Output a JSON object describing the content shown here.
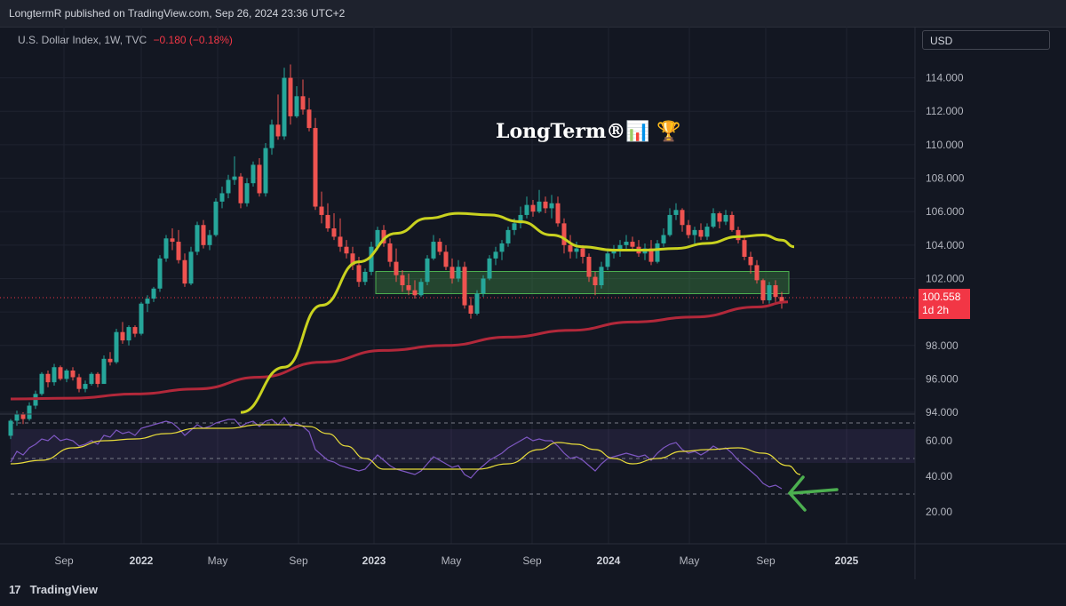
{
  "header": {
    "text": "LongtermR published on TradingView.com, Sep 26, 2024 23:36 UTC+2"
  },
  "legend": {
    "symbol": "U.S. Dollar Index, 1W, TVC",
    "change": "−0.180 (−0.18%)"
  },
  "currency_button": "USD",
  "watermark": "LongTerm®📊 🏆",
  "price_tag": {
    "price": "100.558",
    "countdown": "1d 2h"
  },
  "footer": {
    "brand": "TradingView",
    "logo_mark": "17"
  },
  "colors": {
    "up": "#26a69a",
    "down": "#ef5350",
    "ma_fast": "#c9d21f",
    "ma_slow": "#b2283a",
    "rsi": "#7e57c2",
    "rsi_ma": "#e8dc3a",
    "zone": "#4caf50"
  },
  "chart_data": [
    {
      "type": "candlestick",
      "title": "U.S. Dollar Index, 1W, TVC",
      "x_ticks": [
        "Sep",
        "2022",
        "May",
        "Sep",
        "2023",
        "May",
        "Sep",
        "2024",
        "May",
        "Sep",
        "2025"
      ],
      "y_ticks": [
        "94.000",
        "96.000",
        "98.000",
        "100.000",
        "102.000",
        "104.000",
        "106.000",
        "108.000",
        "110.000",
        "112.000",
        "114.000"
      ],
      "ylim": [
        93.95,
        115.2
      ],
      "last_price": 100.558,
      "ohlc": [
        [
          92.6,
          93.6,
          92.4,
          93.5
        ],
        [
          93.5,
          94.1,
          93.2,
          93.9
        ],
        [
          93.9,
          94.0,
          93.3,
          93.6
        ],
        [
          93.6,
          94.6,
          93.5,
          94.4
        ],
        [
          94.4,
          95.3,
          94.2,
          95.1
        ],
        [
          95.1,
          96.4,
          95.0,
          96.3
        ],
        [
          96.3,
          96.5,
          95.5,
          95.8
        ],
        [
          95.8,
          96.9,
          95.6,
          96.7
        ],
        [
          96.7,
          96.8,
          95.9,
          96.0
        ],
        [
          96.0,
          96.6,
          95.8,
          96.5
        ],
        [
          96.5,
          96.7,
          95.9,
          96.1
        ],
        [
          96.1,
          96.3,
          95.2,
          95.4
        ],
        [
          95.4,
          95.9,
          95.2,
          95.7
        ],
        [
          95.7,
          96.4,
          95.6,
          96.3
        ],
        [
          96.3,
          96.4,
          95.5,
          95.7
        ],
        [
          95.7,
          97.4,
          95.7,
          97.2
        ],
        [
          97.2,
          97.6,
          96.8,
          97.0
        ],
        [
          97.0,
          99.0,
          96.9,
          98.8
        ],
        [
          98.8,
          99.4,
          98.1,
          98.3
        ],
        [
          98.3,
          99.2,
          98.0,
          99.1
        ],
        [
          99.1,
          99.2,
          98.5,
          98.7
        ],
        [
          98.7,
          100.6,
          98.6,
          100.5
        ],
        [
          100.5,
          101.0,
          100.0,
          100.8
        ],
        [
          100.8,
          101.5,
          100.6,
          101.4
        ],
        [
          101.4,
          103.4,
          101.2,
          103.2
        ],
        [
          103.2,
          104.6,
          103.0,
          104.4
        ],
        [
          104.4,
          105.0,
          103.7,
          104.2
        ],
        [
          104.2,
          104.9,
          102.9,
          103.1
        ],
        [
          103.1,
          103.5,
          101.5,
          101.7
        ],
        [
          101.7,
          103.9,
          101.6,
          103.6
        ],
        [
          103.6,
          105.4,
          103.4,
          105.2
        ],
        [
          105.2,
          105.5,
          103.8,
          104.0
        ],
        [
          104.0,
          104.9,
          103.7,
          104.6
        ],
        [
          104.6,
          106.8,
          104.5,
          106.6
        ],
        [
          106.6,
          107.5,
          106.2,
          107.1
        ],
        [
          107.1,
          108.2,
          106.8,
          107.9
        ],
        [
          107.9,
          109.3,
          107.6,
          108.1
        ],
        [
          108.1,
          108.3,
          106.2,
          106.5
        ],
        [
          106.5,
          108.0,
          106.3,
          107.7
        ],
        [
          107.7,
          109.0,
          107.5,
          108.8
        ],
        [
          108.8,
          109.2,
          106.9,
          107.1
        ],
        [
          107.1,
          110.1,
          106.9,
          109.8
        ],
        [
          109.8,
          111.5,
          109.4,
          111.2
        ],
        [
          111.2,
          113.0,
          110.3,
          110.5
        ],
        [
          110.5,
          114.6,
          110.3,
          114.0
        ],
        [
          114.0,
          114.8,
          111.2,
          111.7
        ],
        [
          111.7,
          113.5,
          111.6,
          112.9
        ],
        [
          112.9,
          113.9,
          111.8,
          112.1
        ],
        [
          112.1,
          112.8,
          110.8,
          111.0
        ],
        [
          111.0,
          111.6,
          106.1,
          106.3
        ],
        [
          106.3,
          107.2,
          105.3,
          105.8
        ],
        [
          105.8,
          106.5,
          104.8,
          105.0
        ],
        [
          105.0,
          105.9,
          104.3,
          104.5
        ],
        [
          104.5,
          105.6,
          103.6,
          103.9
        ],
        [
          103.9,
          104.3,
          103.2,
          103.5
        ],
        [
          103.5,
          103.9,
          102.5,
          102.8
        ],
        [
          102.8,
          103.3,
          101.5,
          101.8
        ],
        [
          101.8,
          102.6,
          101.6,
          102.4
        ],
        [
          102.4,
          104.2,
          102.2,
          103.9
        ],
        [
          103.9,
          105.1,
          103.7,
          104.9
        ],
        [
          104.9,
          105.2,
          103.9,
          104.1
        ],
        [
          104.1,
          104.4,
          102.7,
          103.0
        ],
        [
          103.0,
          103.8,
          101.8,
          102.2
        ],
        [
          102.2,
          102.5,
          101.2,
          101.6
        ],
        [
          101.6,
          102.3,
          101.0,
          101.3
        ],
        [
          101.3,
          101.9,
          100.8,
          101.0
        ],
        [
          101.0,
          102.0,
          100.9,
          101.8
        ],
        [
          101.8,
          103.4,
          101.6,
          103.2
        ],
        [
          103.2,
          104.6,
          103.1,
          104.2
        ],
        [
          104.2,
          104.4,
          103.4,
          103.6
        ],
        [
          103.6,
          104.0,
          102.5,
          102.7
        ],
        [
          102.7,
          103.2,
          101.7,
          102.0
        ],
        [
          102.0,
          103.1,
          101.8,
          102.7
        ],
        [
          102.7,
          103.0,
          100.2,
          100.4
        ],
        [
          100.4,
          100.9,
          99.6,
          99.9
        ],
        [
          99.9,
          101.3,
          99.8,
          101.1
        ],
        [
          101.1,
          102.2,
          100.9,
          102.0
        ],
        [
          102.0,
          103.4,
          101.9,
          103.2
        ],
        [
          103.2,
          103.9,
          102.8,
          103.6
        ],
        [
          103.6,
          104.3,
          103.1,
          104.1
        ],
        [
          104.1,
          105.1,
          103.9,
          104.9
        ],
        [
          104.9,
          105.6,
          104.6,
          105.3
        ],
        [
          105.3,
          106.3,
          105.0,
          105.8
        ],
        [
          105.8,
          106.9,
          105.6,
          106.4
        ],
        [
          106.4,
          106.7,
          105.7,
          106.0
        ],
        [
          106.0,
          107.3,
          105.9,
          106.6
        ],
        [
          106.6,
          106.9,
          105.9,
          106.2
        ],
        [
          106.2,
          107.0,
          105.6,
          106.5
        ],
        [
          106.5,
          106.9,
          105.1,
          105.3
        ],
        [
          105.3,
          105.6,
          103.5,
          104.0
        ],
        [
          104.0,
          104.6,
          103.2,
          103.6
        ],
        [
          103.6,
          104.2,
          103.2,
          103.8
        ],
        [
          103.8,
          104.0,
          102.9,
          103.3
        ],
        [
          103.3,
          103.5,
          101.8,
          102.1
        ],
        [
          102.1,
          102.4,
          101.0,
          101.6
        ],
        [
          101.6,
          103.0,
          101.4,
          102.7
        ],
        [
          102.7,
          103.8,
          102.5,
          103.5
        ],
        [
          103.5,
          104.0,
          103.2,
          103.7
        ],
        [
          103.7,
          104.3,
          103.3,
          104.0
        ],
        [
          104.0,
          104.6,
          103.7,
          104.2
        ],
        [
          104.2,
          104.5,
          103.7,
          103.9
        ],
        [
          103.9,
          104.3,
          103.3,
          103.5
        ],
        [
          103.5,
          104.1,
          103.1,
          103.8
        ],
        [
          103.8,
          104.3,
          102.8,
          103.0
        ],
        [
          103.0,
          104.3,
          102.9,
          104.1
        ],
        [
          104.1,
          105.0,
          103.9,
          104.6
        ],
        [
          104.6,
          106.2,
          104.5,
          105.8
        ],
        [
          105.8,
          106.5,
          105.5,
          106.1
        ],
        [
          106.1,
          106.2,
          104.8,
          105.2
        ],
        [
          105.2,
          105.5,
          104.4,
          104.6
        ],
        [
          104.6,
          105.1,
          104.1,
          104.9
        ],
        [
          104.9,
          105.3,
          104.3,
          104.5
        ],
        [
          104.5,
          105.3,
          104.3,
          105.1
        ],
        [
          105.1,
          106.2,
          105.0,
          105.9
        ],
        [
          105.9,
          106.0,
          105.0,
          105.4
        ],
        [
          105.4,
          106.1,
          105.2,
          105.8
        ],
        [
          105.8,
          106.0,
          104.8,
          104.9
        ],
        [
          104.9,
          105.1,
          104.1,
          104.3
        ],
        [
          104.3,
          104.6,
          103.1,
          103.3
        ],
        [
          103.3,
          103.6,
          102.3,
          102.8
        ],
        [
          102.8,
          103.1,
          101.7,
          101.9
        ],
        [
          101.9,
          102.0,
          100.5,
          100.7
        ],
        [
          100.7,
          101.8,
          100.5,
          101.6
        ],
        [
          101.6,
          101.9,
          100.6,
          100.9
        ],
        [
          100.9,
          101.2,
          100.2,
          100.6
        ]
      ]
    },
    {
      "type": "line",
      "title": "",
      "series": [
        {
          "role": "fast moving average",
          "points": [
            [
              37,
              94.0
            ],
            [
              44,
              96.7
            ],
            [
              50,
              100.4
            ],
            [
              56,
              103.0
            ],
            [
              62,
              104.7
            ],
            [
              67,
              105.6
            ],
            [
              72,
              105.9
            ],
            [
              77,
              105.8
            ],
            [
              82,
              105.4
            ],
            [
              87,
              104.6
            ],
            [
              92,
              103.9
            ],
            [
              97,
              103.7
            ],
            [
              102,
              103.7
            ],
            [
              107,
              103.8
            ],
            [
              112,
              104.1
            ],
            [
              117,
              104.5
            ],
            [
              121,
              104.6
            ],
            [
              124,
              104.3
            ],
            [
              126,
              103.9
            ]
          ]
        },
        {
          "role": "slow moving average",
          "points": [
            [
              0,
              94.8
            ],
            [
              10,
              94.85
            ],
            [
              20,
              95.1
            ],
            [
              30,
              95.4
            ],
            [
              40,
              96.1
            ],
            [
              50,
              97.0
            ],
            [
              60,
              97.7
            ],
            [
              70,
              98.0
            ],
            [
              80,
              98.5
            ],
            [
              90,
              98.9
            ],
            [
              100,
              99.4
            ],
            [
              110,
              99.7
            ],
            [
              120,
              100.3
            ],
            [
              125,
              100.6
            ]
          ]
        }
      ]
    },
    {
      "type": "line",
      "title": "",
      "y_ticks": [
        "20.00",
        "40.00",
        "60.00"
      ],
      "ylim": [
        18.5,
        75.0
      ],
      "guides": [
        30,
        50,
        70
      ],
      "series": [
        {
          "role": "rsi",
          "values": [
            48,
            54,
            52,
            56,
            58,
            61,
            60,
            63,
            60,
            61,
            60,
            57,
            58,
            60,
            58,
            63,
            62,
            66,
            64,
            65,
            63,
            67,
            68,
            69,
            70,
            71,
            70,
            67,
            63,
            66,
            69,
            67,
            68,
            70,
            71,
            72,
            72,
            68,
            70,
            71,
            68,
            71,
            72,
            69,
            73,
            68,
            70,
            68,
            65,
            55,
            52,
            49,
            48,
            46,
            45,
            44,
            43,
            44,
            48,
            52,
            49,
            46,
            44,
            43,
            42,
            41,
            43,
            47,
            51,
            49,
            47,
            45,
            46,
            41,
            39,
            43,
            46,
            49,
            51,
            53,
            56,
            58,
            60,
            62,
            60,
            61,
            60,
            60,
            57,
            53,
            50,
            51,
            49,
            46,
            43,
            47,
            50,
            51,
            52,
            53,
            52,
            51,
            52,
            49,
            53,
            56,
            58,
            59,
            55,
            53,
            54,
            52,
            54,
            57,
            55,
            56,
            53,
            49,
            46,
            43,
            40,
            36,
            34,
            35,
            33
          ]
        },
        {
          "role": "rsi moving average",
          "points": [
            [
              0,
              47
            ],
            [
              5,
              49
            ],
            [
              10,
              56
            ],
            [
              15,
              60
            ],
            [
              20,
              61
            ],
            [
              25,
              64
            ],
            [
              30,
              67
            ],
            [
              35,
              67
            ],
            [
              40,
              69
            ],
            [
              45,
              69
            ],
            [
              48,
              68
            ],
            [
              51,
              64
            ],
            [
              54,
              57
            ],
            [
              57,
              50
            ],
            [
              60,
              44
            ],
            [
              65,
              44
            ],
            [
              70,
              44
            ],
            [
              75,
              44
            ],
            [
              80,
              47
            ],
            [
              85,
              55
            ],
            [
              88,
              59
            ],
            [
              91,
              58
            ],
            [
              94,
              55
            ],
            [
              97,
              50
            ],
            [
              100,
              47
            ],
            [
              104,
              50
            ],
            [
              108,
              54
            ],
            [
              112,
              55
            ],
            [
              117,
              56
            ],
            [
              121,
              53
            ],
            [
              125,
              46
            ],
            [
              127,
              41
            ]
          ]
        }
      ]
    }
  ]
}
